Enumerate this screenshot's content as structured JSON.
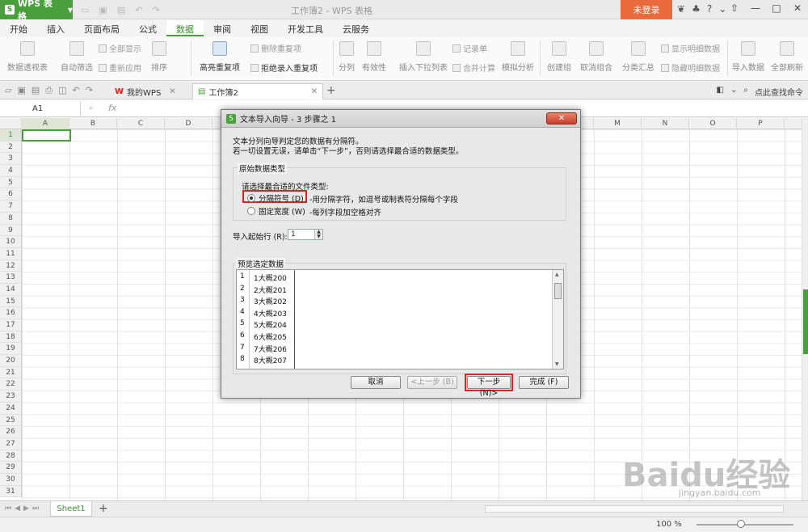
{
  "titlebar": {
    "app_name": "WPS 表格",
    "window_title": "工作簿2 - WPS 表格",
    "login": "未登录"
  },
  "menu": [
    "开始",
    "插入",
    "页面布局",
    "公式",
    "数据",
    "审阅",
    "视图",
    "开发工具",
    "云服务"
  ],
  "ribbon": {
    "pivot": "数据透视表",
    "autofilter": "自动筛选",
    "show_all": "全部显示",
    "reapply": "重新应用",
    "sort": "排序",
    "highlight_dup": "高亮重复项",
    "delete_dup": "删除重复项",
    "reject_dup": "拒绝录入重复项",
    "split": "分列",
    "validity": "有效性",
    "insert_dropdown": "插入下拉列表",
    "records": "记录单",
    "consolidate": "合并计算",
    "simulate": "模拟分析",
    "group": "创建组",
    "ungroup": "取消组合",
    "subtotal": "分类汇总",
    "show_detail": "显示明细数据",
    "hide_detail": "隐藏明细数据",
    "import": "导入数据",
    "refresh_all": "全部刷新"
  },
  "tabs": {
    "mywps": "我的WPS",
    "workbook": "工作簿2",
    "search": "点此查找命令"
  },
  "formula": {
    "cell_ref": "A1",
    "fx": "fx"
  },
  "columns": [
    "A",
    "B",
    "C",
    "D",
    "E",
    "F",
    "G",
    "H",
    "I",
    "J",
    "K",
    "L",
    "M",
    "N",
    "O",
    "P"
  ],
  "sheet": {
    "name": "Sheet1",
    "zoom": "100 %"
  },
  "dialog": {
    "title": "文本导入向导 - 3 步骤之 1",
    "close": "✕",
    "intro1": "文本分列向导判定您的数据有分隔符。",
    "intro2": "若一切设置无误，请单击“下一步”，否则请选择最合适的数据类型。",
    "group_title": "原始数据类型",
    "choose_label": "请选择最合适的文件类型:",
    "opt_delimited": "分隔符号 (D)",
    "opt_delimited_desc": "-用分隔字符，如逗号或制表符分隔每个字段",
    "opt_fixed": "固定宽度 (W)",
    "opt_fixed_desc": "-每列字段加空格对齐",
    "start_row_label": "导入起始行 (R):",
    "start_row_value": "1",
    "preview_label": "预览选定数据",
    "preview_rows": [
      {
        "n": "1",
        "v": "1大概200"
      },
      {
        "n": "2",
        "v": "2大概201"
      },
      {
        "n": "3",
        "v": "3大概202"
      },
      {
        "n": "4",
        "v": "4大概203"
      },
      {
        "n": "5",
        "v": "5大概204"
      },
      {
        "n": "6",
        "v": "6大概205"
      },
      {
        "n": "7",
        "v": "7大概206"
      },
      {
        "n": "8",
        "v": "8大概207"
      }
    ],
    "btn_cancel": "取消",
    "btn_back": "<上一步 (B)",
    "btn_next": "下一步 (N)>",
    "btn_finish": "完成 (F)"
  },
  "watermark": {
    "text": "Baidu经验",
    "sub": "jingyan.baidu.com"
  },
  "colors": {
    "accent": "#4a9f3d",
    "login": "#e96b3c",
    "highlight": "#d9261c"
  }
}
